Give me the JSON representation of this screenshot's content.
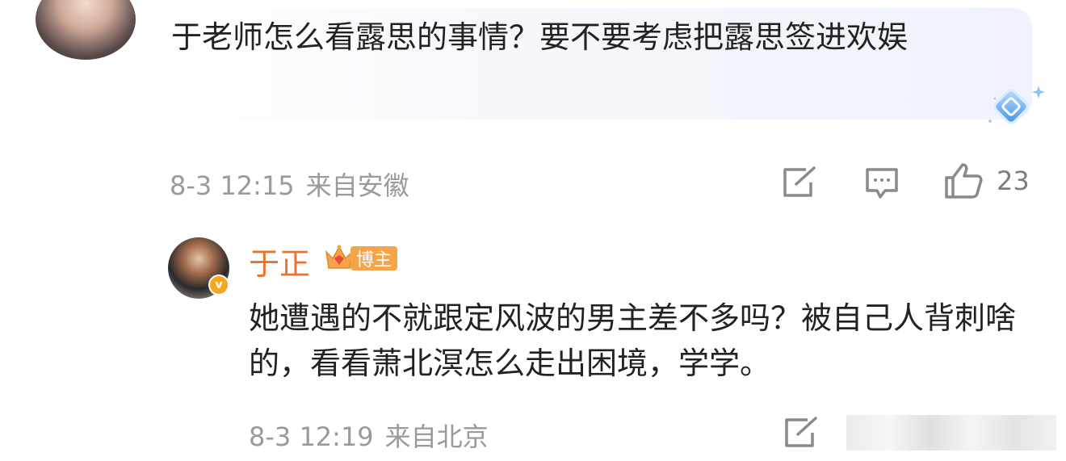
{
  "comment": {
    "text": "于老师怎么看露思的事情？要不要考虑把露思签进欢娱",
    "time": "8-3 12:15",
    "location": "来自安徽",
    "like_count": "23"
  },
  "reply": {
    "username": "于正",
    "badge": "博主",
    "text": "她遭遇的不就跟定风波的男主差不多吗？被自己人背刺啥的，看看萧北溟怎么走出困境，学学。",
    "time": "8-3 12:19",
    "location": "来自北京"
  },
  "colors": {
    "username": "#e8732c",
    "badge": "#f5a44a",
    "meta": "#9a9a9a"
  },
  "icons": [
    "share-icon",
    "comment-icon",
    "like-icon",
    "sparkle-icon",
    "crown-icon",
    "verified-icon"
  ]
}
